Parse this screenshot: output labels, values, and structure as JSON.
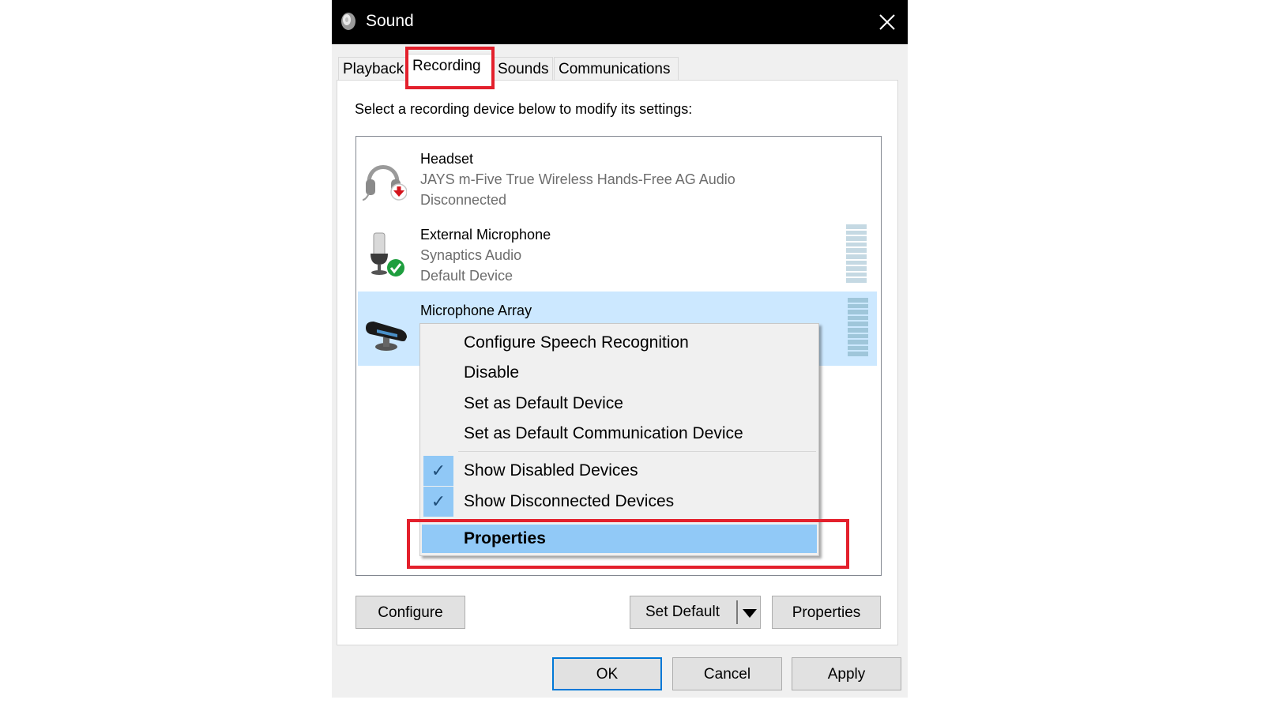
{
  "window": {
    "title": "Sound",
    "title_icon": "speaker-icon",
    "close_icon": "close-icon"
  },
  "tabs": [
    {
      "label": "Playback",
      "active": false
    },
    {
      "label": "Recording",
      "active": true
    },
    {
      "label": "Sounds",
      "active": false
    },
    {
      "label": "Communications",
      "active": false
    }
  ],
  "instructions": "Select a recording device below to modify its settings:",
  "devices": [
    {
      "name": "Headset",
      "description": "JAYS m-Five True Wireless Hands-Free AG Audio",
      "status": "Disconnected",
      "icon": "headset-icon",
      "badge": "disconnected-arrow-badge",
      "selected": false
    },
    {
      "name": "External Microphone",
      "description": "Synaptics Audio",
      "status": "Default Device",
      "icon": "microphone-icon",
      "badge": "default-check-badge",
      "selected": false,
      "level": 0
    },
    {
      "name": "Microphone Array",
      "description": "",
      "status": "",
      "icon": "microphone-array-icon",
      "selected": true,
      "level": 0.08
    }
  ],
  "context_menu": {
    "items": [
      {
        "label": "Configure Speech Recognition",
        "checked": false
      },
      {
        "label": "Disable",
        "checked": false
      },
      {
        "label": "Set as Default Device",
        "checked": false
      },
      {
        "label": "Set as Default Communication Device",
        "checked": false
      },
      {
        "label": "Show Disabled Devices",
        "checked": true
      },
      {
        "label": "Show Disconnected Devices",
        "checked": true
      },
      {
        "label": "Properties",
        "checked": false,
        "highlighted": true,
        "bold": true
      }
    ],
    "check_glyph": "✓"
  },
  "buttons": {
    "configure": "Configure",
    "set_default": "Set Default",
    "properties": "Properties",
    "ok": "OK",
    "cancel": "Cancel",
    "apply": "Apply"
  },
  "annotation_color": "#e3202c",
  "selection_color": "#cce8ff",
  "menu_highlight_color": "#91c9f7"
}
